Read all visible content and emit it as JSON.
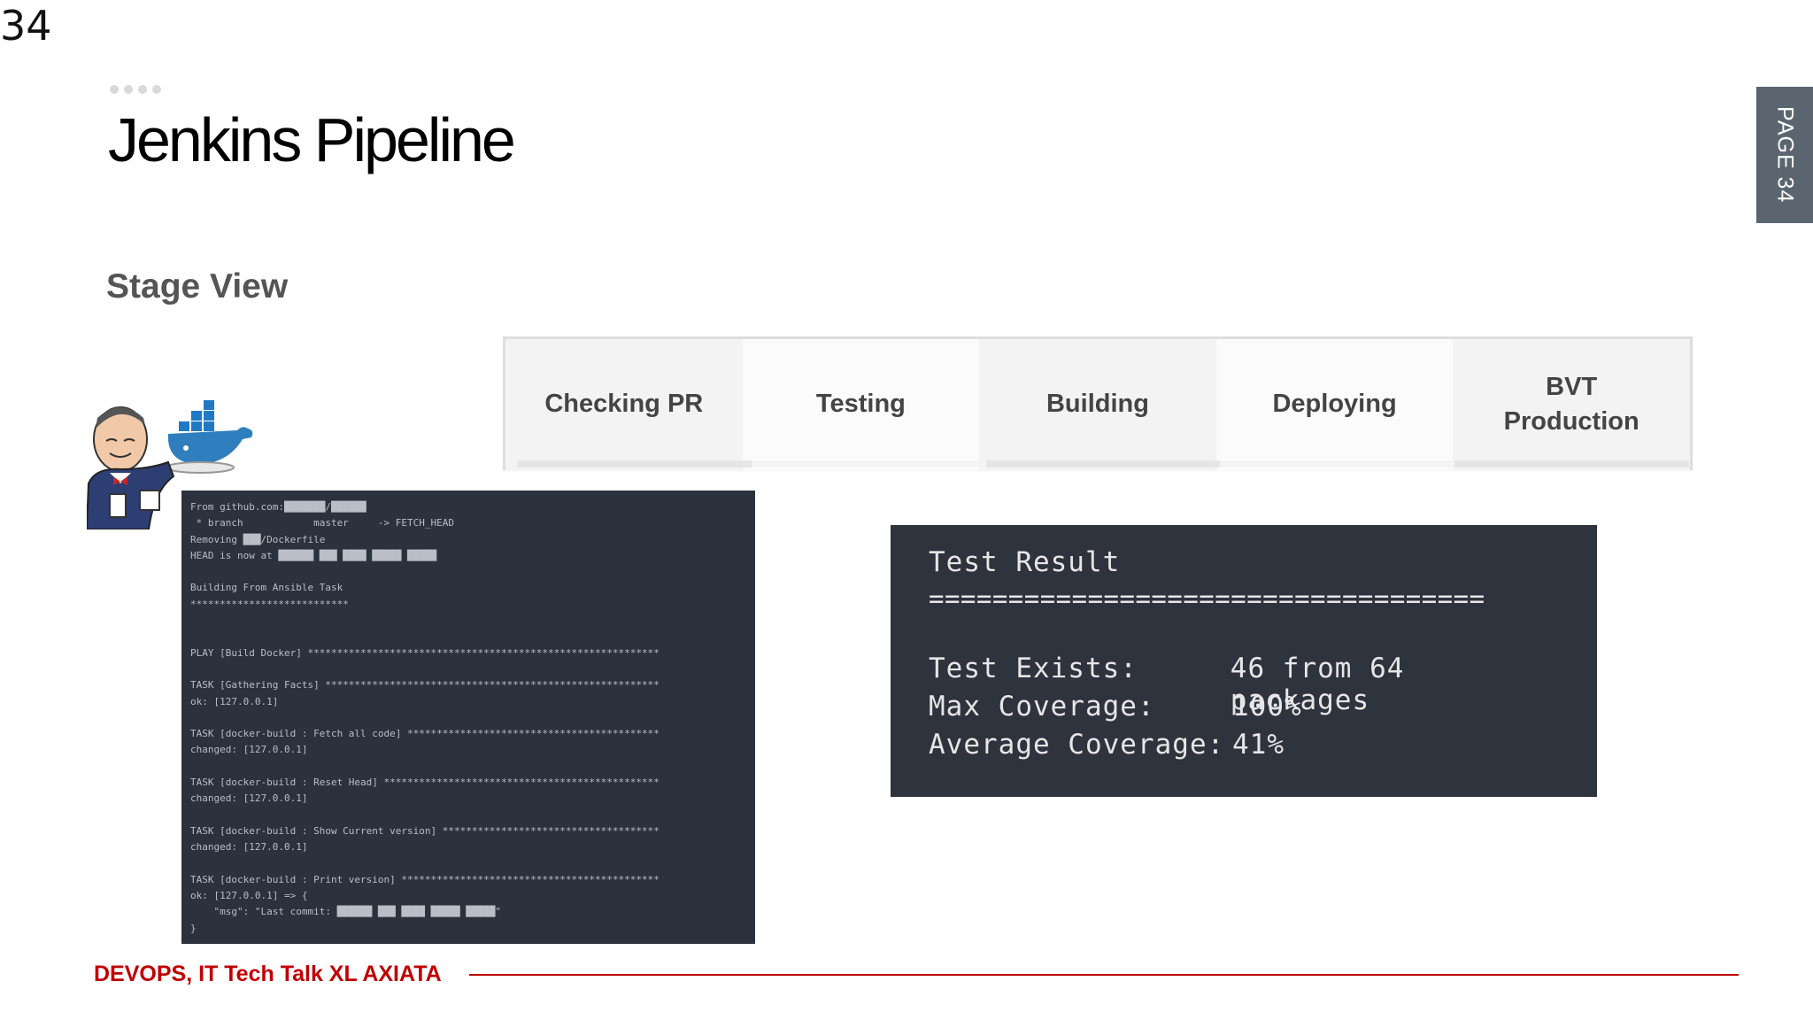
{
  "slide": {
    "number": "34",
    "page_tab": "PAGE 34",
    "title": "Jenkins Pipeline"
  },
  "stage_view": {
    "label": "Stage View",
    "stages": [
      "Checking PR",
      "Testing",
      "Building",
      "Deploying",
      "BVT\nProduction"
    ]
  },
  "console_log": {
    "lines": [
      "From github.com:███████/██████",
      " * branch            master     -> FETCH_HEAD",
      "Removing ███/Dockerfile",
      "HEAD is now at ██████ ███ ████ █████ █████",
      "",
      "Building From Ansible Task",
      "***************************",
      "",
      "",
      "PLAY [Build Docker] ************************************************************",
      "",
      "TASK [Gathering Facts] *********************************************************",
      "ok: [127.0.0.1]",
      "",
      "TASK [docker-build : Fetch all code] *******************************************",
      "changed: [127.0.0.1]",
      "",
      "TASK [docker-build : Reset Head] ***********************************************",
      "changed: [127.0.0.1]",
      "",
      "TASK [docker-build : Show Current version] *************************************",
      "changed: [127.0.0.1]",
      "",
      "TASK [docker-build : Print version] ********************************************",
      "ok: [127.0.0.1] => {",
      "    \"msg\": \"Last commit: ██████ ███ ████ █████ █████\"",
      "}"
    ]
  },
  "test_result": {
    "title": "Test Result",
    "separator": "===================================",
    "rows": [
      {
        "label": "Test Exists:",
        "value": "46 from 64 packages"
      },
      {
        "label": "Max Coverage:",
        "value": "100%"
      },
      {
        "label": "Average Coverage:",
        "value": "41%"
      }
    ]
  },
  "footer": {
    "text": "DEVOPS, IT Tech Talk XL AXIATA"
  },
  "colors": {
    "accent_red": "#c00000",
    "terminal_bg": "#2b313d",
    "page_tab_bg": "#5a6570"
  },
  "icons": {
    "mascot": "jenkins-docker-mascot-icon"
  }
}
